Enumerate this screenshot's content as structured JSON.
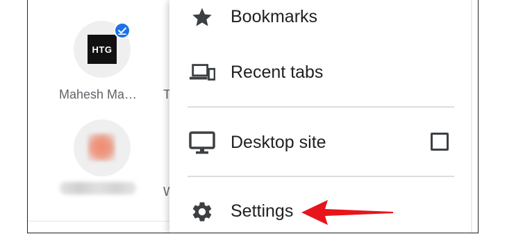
{
  "background": {
    "tiles": [
      {
        "label": "Mahesh Ma…",
        "logo_text": "HTG",
        "verified_icon": "verified-check-badge-icon",
        "peek_letter": "T"
      },
      {
        "label": "",
        "logo_text": "",
        "peek_letter": "W"
      }
    ]
  },
  "menu": {
    "items": [
      {
        "label": "Bookmarks",
        "icon": "star-icon"
      },
      {
        "label": "Recent tabs",
        "icon": "devices-icon"
      },
      {
        "label": "Desktop site",
        "icon": "monitor-icon",
        "checkbox_checked": false
      },
      {
        "label": "Settings",
        "icon": "gear-icon"
      }
    ]
  },
  "annotation": {
    "arrow_icon": "red-arrow-pointing-left",
    "color": "#e8141c"
  },
  "colors": {
    "text": "#202124",
    "icon": "#3c4043",
    "badge": "#1a73e8",
    "divider": "#dadce0"
  }
}
